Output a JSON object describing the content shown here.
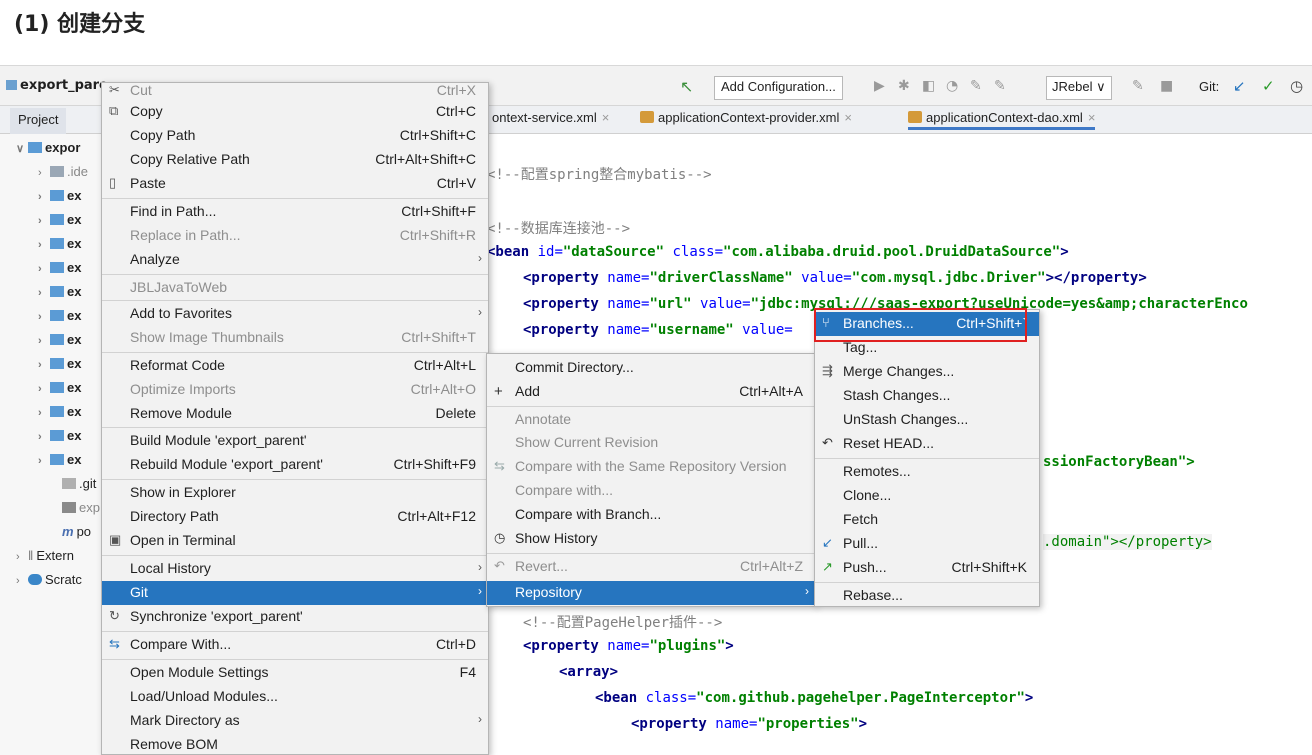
{
  "heading": "(1) 创建分支",
  "toolbar": {
    "project_title": "export_pare",
    "add_configuration": "Add Configuration...",
    "jrebel": "JRebel ∨",
    "git_label": "Git:"
  },
  "tabs": {
    "project": "Project",
    "editor_tabs": [
      {
        "label": "ontext-service.xml"
      },
      {
        "label": "applicationContext-provider.xml"
      },
      {
        "label": "applicationContext-dao.xml"
      }
    ]
  },
  "tree": [
    {
      "label": "expor",
      "bold": true
    },
    {
      "label": ".ide"
    },
    {
      "label": "ex"
    },
    {
      "label": "ex"
    },
    {
      "label": "ex"
    },
    {
      "label": "ex"
    },
    {
      "label": "ex"
    },
    {
      "label": "ex"
    },
    {
      "label": "ex"
    },
    {
      "label": "ex"
    },
    {
      "label": "ex"
    },
    {
      "label": "ex"
    },
    {
      "label": "ex"
    },
    {
      "label": "ex"
    },
    {
      "label": ".git"
    },
    {
      "label": "exp"
    },
    {
      "label": "po"
    },
    {
      "label": "Extern"
    },
    {
      "label": "Scratc"
    }
  ],
  "code": {
    "comment_spring": "<!--配置spring整合mybatis-->",
    "comment_pool": "<!--数据库连接池-->",
    "bean_tag": "<bean",
    "bean_id_attr": " id=",
    "bean_id_val": "\"dataSource\"",
    "bean_class_attr": " class=",
    "bean_class_val": "\"com.alibaba.druid.pool.DruidDataSource\"",
    "bean_close": ">",
    "prop1_tag": "<property",
    "prop1_name_attr": " name=",
    "prop1_name_val": "\"driverClassName\"",
    "prop1_value_attr": " value=",
    "prop1_value_val": "\"com.mysql.jdbc.Driver\"",
    "prop1_close": "></property>",
    "prop2_tag": "<property",
    "prop2_name_attr": " name=",
    "prop2_name_val": "\"url\"",
    "prop2_value_attr": " value=",
    "prop2_value_val": "\"jdbc:mysql:///saas-export?useUnicode=yes&amp;characterEnco",
    "prop3_tag": "<property",
    "prop3_name_attr": " name=",
    "prop3_name_val": "\"username\"",
    "prop3_value_attr": " value=",
    "session_factory": "ssionFactoryBean\">",
    "domain_frag": ".domain\"></property>",
    "comment_pagehelper": "<!--配置PageHelper插件-->",
    "plugins_tag": "<property",
    "plugins_name_attr": " name=",
    "plugins_name_val": "\"plugins\"",
    "plugins_close": ">",
    "array_tag": "<array>",
    "interceptor_tag": "<bean",
    "interceptor_class_attr": " class=",
    "interceptor_class_val": "\"com.github.pagehelper.PageInterceptor\"",
    "interceptor_close": ">",
    "properties_tag": "<property",
    "properties_name_attr": " name=",
    "properties_name_val": "\"properties\"",
    "properties_close": ">"
  },
  "context_menu": [
    {
      "label": "Cut",
      "shortcut": "Ctrl+X",
      "disabled": true
    },
    {
      "label": "Copy",
      "shortcut": "Ctrl+C",
      "icon": "copy"
    },
    {
      "label": "Copy Path",
      "shortcut": "Ctrl+Shift+C"
    },
    {
      "label": "Copy Relative Path",
      "shortcut": "Ctrl+Alt+Shift+C"
    },
    {
      "label": "Paste",
      "shortcut": "Ctrl+V",
      "icon": "paste"
    },
    {
      "label": "Find in Path...",
      "shortcut": "Ctrl+Shift+F"
    },
    {
      "label": "Replace in Path...",
      "shortcut": "Ctrl+Shift+R",
      "disabled": true
    },
    {
      "label": "Analyze",
      "submenu": true
    },
    {
      "label": "JBLJavaToWeb",
      "disabled": true
    },
    {
      "label": "Add to Favorites",
      "submenu": true
    },
    {
      "label": "Show Image Thumbnails",
      "shortcut": "Ctrl+Shift+T",
      "disabled": true
    },
    {
      "label": "Reformat Code",
      "shortcut": "Ctrl+Alt+L"
    },
    {
      "label": "Optimize Imports",
      "shortcut": "Ctrl+Alt+O",
      "disabled": true
    },
    {
      "label": "Remove Module",
      "shortcut": "Delete"
    },
    {
      "label": "Build Module 'export_parent'"
    },
    {
      "label": "Rebuild Module 'export_parent'",
      "shortcut": "Ctrl+Shift+F9"
    },
    {
      "label": "Show in Explorer"
    },
    {
      "label": "Directory Path",
      "shortcut": "Ctrl+Alt+F12"
    },
    {
      "label": "Open in Terminal",
      "icon": "terminal"
    },
    {
      "label": "Local History",
      "submenu": true
    },
    {
      "label": "Git",
      "submenu": true,
      "highlighted": true
    },
    {
      "label": "Synchronize 'export_parent'",
      "icon": "sync"
    },
    {
      "label": "Compare With...",
      "shortcut": "Ctrl+D",
      "icon": "compare"
    },
    {
      "label": "Open Module Settings",
      "shortcut": "F4"
    },
    {
      "label": "Load/Unload Modules..."
    },
    {
      "label": "Mark Directory as",
      "submenu": true
    },
    {
      "label": "Remove BOM"
    }
  ],
  "git_submenu": [
    {
      "label": "Commit Directory..."
    },
    {
      "label": "Add",
      "shortcut": "Ctrl+Alt+A",
      "icon": "plus"
    },
    {
      "label": "Annotate",
      "disabled": true
    },
    {
      "label": "Show Current Revision",
      "disabled": true
    },
    {
      "label": "Compare with the Same Repository Version",
      "disabled": true,
      "icon": "compare"
    },
    {
      "label": "Compare with...",
      "disabled": true
    },
    {
      "label": "Compare with Branch..."
    },
    {
      "label": "Show History",
      "icon": "clock"
    },
    {
      "label": "Revert...",
      "shortcut": "Ctrl+Alt+Z",
      "disabled": true,
      "icon": "revert"
    },
    {
      "label": "Repository",
      "submenu": true,
      "highlighted": true
    }
  ],
  "repository_submenu": [
    {
      "label": "Branches...",
      "shortcut": "Ctrl+Shift+`",
      "highlighted": true,
      "icon": "branch"
    },
    {
      "label": "Tag..."
    },
    {
      "label": "Merge Changes...",
      "icon": "merge"
    },
    {
      "label": "Stash Changes..."
    },
    {
      "label": "UnStash Changes..."
    },
    {
      "label": "Reset HEAD...",
      "icon": "revert"
    },
    {
      "label": "Remotes..."
    },
    {
      "label": "Clone..."
    },
    {
      "label": "Fetch"
    },
    {
      "label": "Pull...",
      "icon": "pull"
    },
    {
      "label": "Push...",
      "shortcut": "Ctrl+Shift+K",
      "icon": "push"
    },
    {
      "label": "Rebase..."
    }
  ],
  "colors": {
    "highlight": "#2675bf",
    "annotation_box": "#e02020"
  }
}
